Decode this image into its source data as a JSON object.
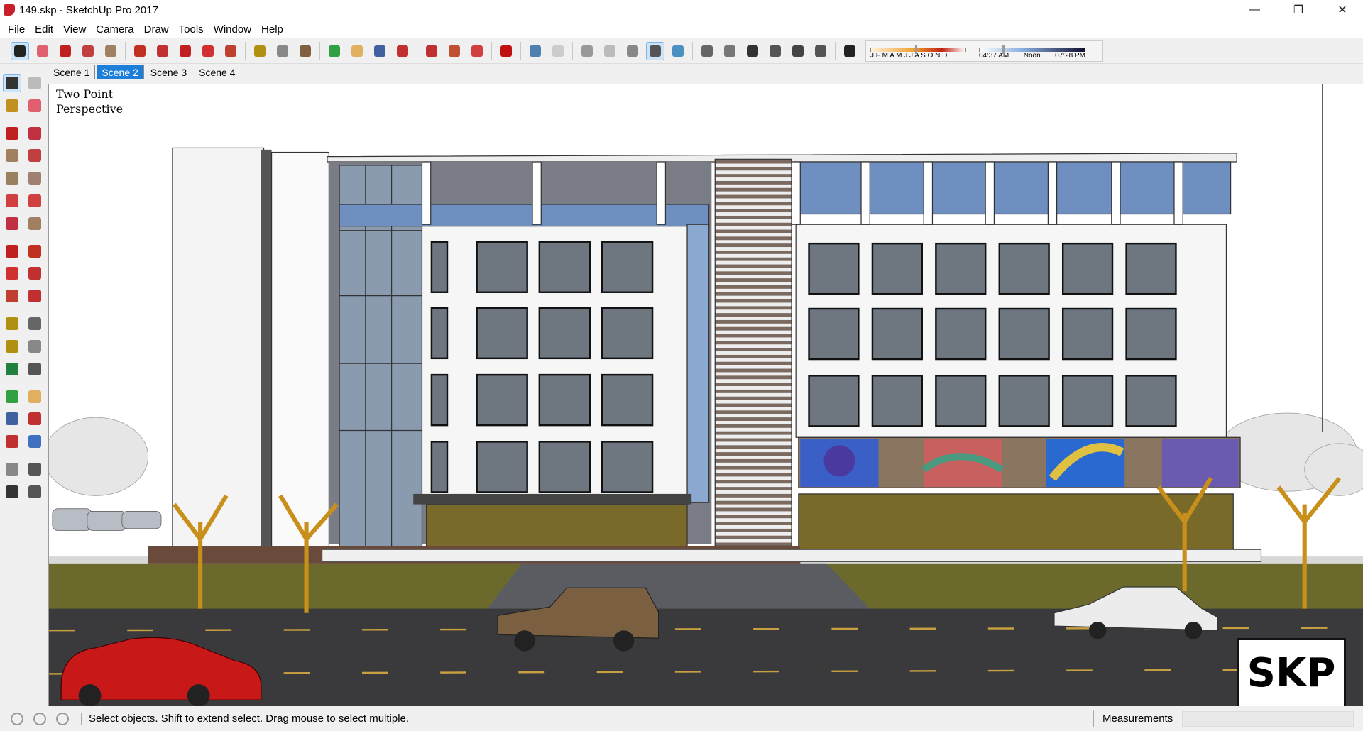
{
  "window": {
    "title": "149.skp - SketchUp Pro 2017",
    "minimize": "—",
    "restore": "❐",
    "close": "✕"
  },
  "menu": [
    "File",
    "Edit",
    "View",
    "Camera",
    "Draw",
    "Tools",
    "Window",
    "Help"
  ],
  "toolbar": [
    {
      "name": "select-icon",
      "color": "#222",
      "active": true
    },
    {
      "name": "eraser-icon",
      "color": "#e06070"
    },
    {
      "name": "pencil-icon",
      "color": "#c02020"
    },
    {
      "name": "arc-icon",
      "color": "#c04040"
    },
    {
      "name": "rectangle-icon",
      "color": "#a08060"
    },
    "|",
    {
      "name": "push-pull-icon",
      "color": "#c03020"
    },
    {
      "name": "follow-me-icon",
      "color": "#c03030"
    },
    {
      "name": "move-icon",
      "color": "#c02020"
    },
    {
      "name": "rotate-icon",
      "color": "#d03030"
    },
    {
      "name": "scale-icon",
      "color": "#c04030"
    },
    "|",
    {
      "name": "tape-measure-icon",
      "color": "#b09010"
    },
    {
      "name": "text-icon",
      "color": "#888"
    },
    {
      "name": "paint-bucket-icon",
      "color": "#806040"
    },
    "|",
    {
      "name": "orbit-icon",
      "color": "#30a040"
    },
    {
      "name": "pan-icon",
      "color": "#e0b060"
    },
    {
      "name": "zoom-icon",
      "color": "#4060a0"
    },
    {
      "name": "zoom-extents-icon",
      "color": "#c03030"
    },
    "|",
    {
      "name": "warehouse-icon",
      "color": "#c03030"
    },
    {
      "name": "extension-warehouse-icon",
      "color": "#c05030"
    },
    {
      "name": "layout-icon",
      "color": "#d04040"
    },
    "|",
    {
      "name": "ruby-icon",
      "color": "#c01010"
    },
    "|",
    {
      "name": "xray-icon",
      "color": "#5080b0"
    },
    {
      "name": "back-edges-icon",
      "color": "#ccc"
    },
    "|",
    {
      "name": "wireframe-icon",
      "color": "#999"
    },
    {
      "name": "hidden-line-icon",
      "color": "#bbb"
    },
    {
      "name": "shaded-icon",
      "color": "#888"
    },
    {
      "name": "shaded-textures-icon",
      "color": "#555",
      "active": true
    },
    {
      "name": "monochrome-icon",
      "color": "#4a90c0"
    },
    "|",
    {
      "name": "iso-view-icon",
      "color": "#666"
    },
    {
      "name": "top-view-icon",
      "color": "#777"
    },
    {
      "name": "front-view-icon",
      "color": "#333"
    },
    {
      "name": "right-view-icon",
      "color": "#555"
    },
    {
      "name": "back-view-icon",
      "color": "#444"
    },
    {
      "name": "left-view-icon",
      "color": "#555"
    },
    "|",
    {
      "name": "shadows-icon",
      "color": "#222"
    }
  ],
  "shadow": {
    "months": "J F M A M J J A S O N D",
    "month_position": 0.47,
    "time_start": "04:37 AM",
    "time_mid": "Noon",
    "time_end": "07:28 PM",
    "time_position": 0.22
  },
  "scenes": [
    {
      "label": "Scene 1"
    },
    {
      "label": "Scene 2",
      "active": true
    },
    {
      "label": "Scene 3"
    },
    {
      "label": "Scene 4"
    }
  ],
  "left_tools": [
    "select-icon",
    "component-icon",
    "paint-bucket-icon",
    "eraser-icon",
    "line-icon",
    "freehand-icon",
    "rectangle-icon",
    "rotated-rectangle-icon",
    "circle-icon",
    "polygon-icon",
    "arc-icon",
    "two-point-arc-icon",
    "three-point-arc-icon",
    "pie-icon",
    "move-icon",
    "push-pull-icon",
    "rotate-icon",
    "follow-me-icon",
    "scale-icon",
    "offset-icon",
    "tape-measure-icon",
    "dimension-icon",
    "protractor-icon",
    "text-icon",
    "axes-icon",
    "3d-text-icon",
    "orbit-icon",
    "pan-icon",
    "zoom-icon",
    "zoom-window-icon",
    "zoom-extents-icon",
    "previous-view-icon",
    "position-camera-icon",
    "look-around-icon",
    "walk-icon",
    "section-plane-icon"
  ],
  "viewport": {
    "camera_label": "Two Point\nPerspective",
    "logo": "SKP"
  },
  "status": {
    "text": "Select objects. Shift to extend select. Drag mouse to select multiple.",
    "measurements_label": "Measurements",
    "measurements_value": ""
  }
}
